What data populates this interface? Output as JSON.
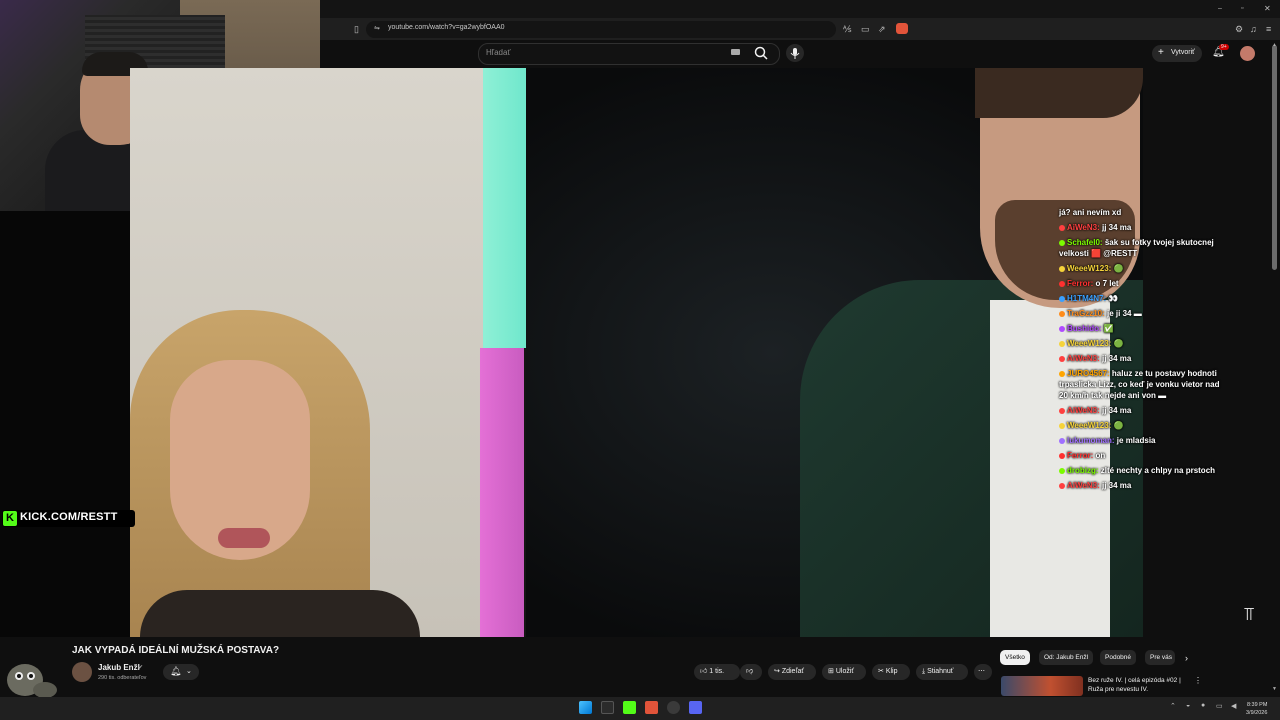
{
  "browser": {
    "url": "youtube.com/watch?v=ga2wybfOAA0"
  },
  "youtube": {
    "search_placeholder": "Hľadať",
    "create_label": "Vytvoriť",
    "notifications_badge": "9+"
  },
  "stream_overlay": {
    "kick_url": "KICK.COM/RESTT"
  },
  "chat": [
    {
      "user": "",
      "text": "já? ani nevím xd",
      "color": "#ffffff"
    },
    {
      "user": "AiWeN3:",
      "text": "jj 34 ma",
      "color": "#ff4040"
    },
    {
      "user": "Schafel0:",
      "text": "šak su fotky tvojej skutocnej velkosti 🟥 @RESTT",
      "color": "#7cfc00"
    },
    {
      "user": "WeeeW123:",
      "text": "🟢",
      "color": "#f5d33a"
    },
    {
      "user": "Ferror:",
      "text": "o 7 let",
      "color": "#ff3030"
    },
    {
      "user": "H1TM4N7:",
      "text": "👀",
      "color": "#3aa0ff"
    },
    {
      "user": "TraGzz10:",
      "text": "je ji 34 ▬",
      "color": "#ff8c1a"
    },
    {
      "user": "Bushido:",
      "text": "✅",
      "color": "#b04aff"
    },
    {
      "user": "WeeeW123:",
      "text": "🟢",
      "color": "#f5d33a"
    },
    {
      "user": "AiWeN3:",
      "text": "jj 34 ma",
      "color": "#ff4040"
    },
    {
      "user": "JURO4567:",
      "text": "haluz ze tu postavy hodnoti trpaslicka Lizz, co keď je vonku vietor nad 20 km/h tak nejde ani von ▬",
      "color": "#ffa500"
    },
    {
      "user": "AiWeN3:",
      "text": "jj 34 ma",
      "color": "#ff4040"
    },
    {
      "user": "WeeeW123:",
      "text": "🟢",
      "color": "#f5d33a"
    },
    {
      "user": "lukumoman:",
      "text": "je mladsia",
      "color": "#a070ff"
    },
    {
      "user": "Ferror:",
      "text": "on",
      "color": "#ff3030"
    },
    {
      "user": "drobizg:",
      "text": "zlté nechty a chlpy na prstoch",
      "color": "#7cfc00"
    },
    {
      "user": "AiWeN3:",
      "text": "jj 34 ma",
      "color": "#ff4040"
    }
  ],
  "video": {
    "title": "JAK VYPADÁ IDEÁLNÍ MUŽSKÁ POSTAVA?",
    "channel": "Jakub Enžl",
    "subscribers": "290 tis. odberateľov",
    "likes": "1 tis.",
    "share_label": "Zdieľať",
    "save_label": "Uložiť",
    "clip_label": "Klip",
    "download_label": "Stiahnuť"
  },
  "filter_chips": [
    "Všetko",
    "Od: Jakub Enžl",
    "Podobné",
    "Pre vás"
  ],
  "recommendation": {
    "title": "Bez ruže IV. | celá epizóda #02 | Ruža pre nevestu IV."
  },
  "taskbar": {
    "time": "8:39 PM",
    "date": "3/9/2026"
  },
  "colors": {
    "kick_green": "#53fc18",
    "youtube_bg": "#0f0f0f",
    "pill_bg": "#272727"
  }
}
